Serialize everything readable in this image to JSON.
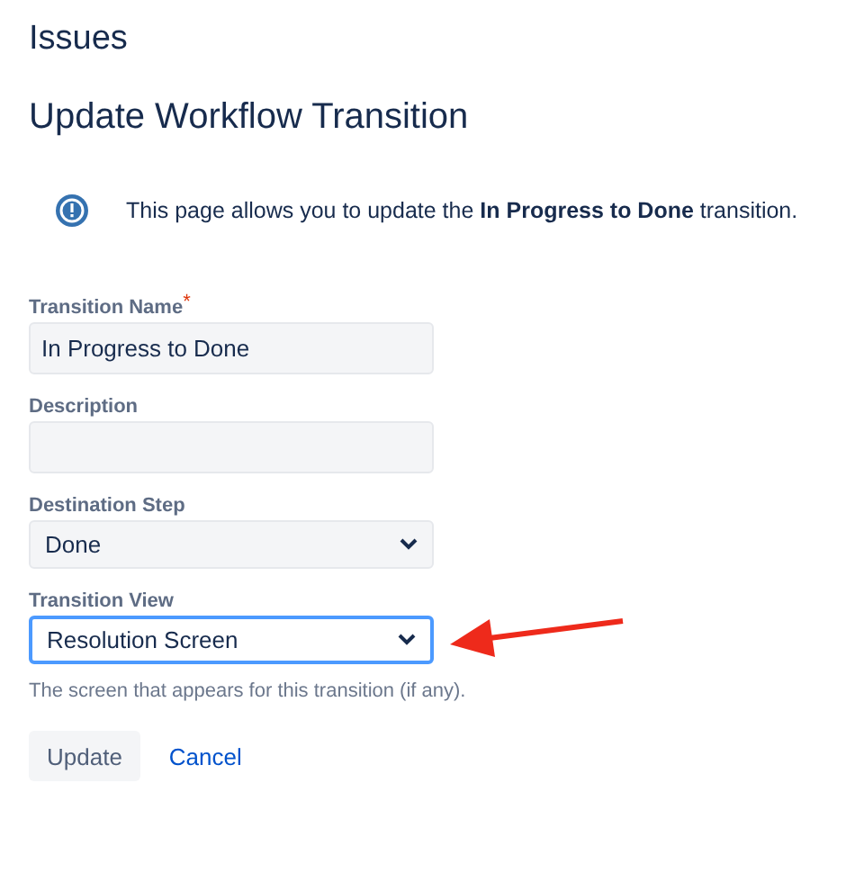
{
  "breadcrumb": "Issues",
  "title": "Update Workflow Transition",
  "info": "This page allows you to update the **In Progress to Done** transition.",
  "fields": [
    {
      "kind": "text",
      "label": "Transition Name",
      "required_mark": "*",
      "value": "In Progress to Done",
      "focused": false
    },
    {
      "kind": "text",
      "label": "Description",
      "focused": false
    },
    {
      "kind": "select",
      "label": "Destination Step",
      "value": "Done",
      "focused": false
    },
    {
      "kind": "select",
      "label": "Transition View",
      "value": "Resolution Screen",
      "focused": true,
      "help": "The screen that appears for this transition (if any)."
    }
  ],
  "buttons": [
    {
      "kind": "primary",
      "label": "Update"
    },
    {
      "kind": "link",
      "label": "Cancel"
    }
  ]
}
